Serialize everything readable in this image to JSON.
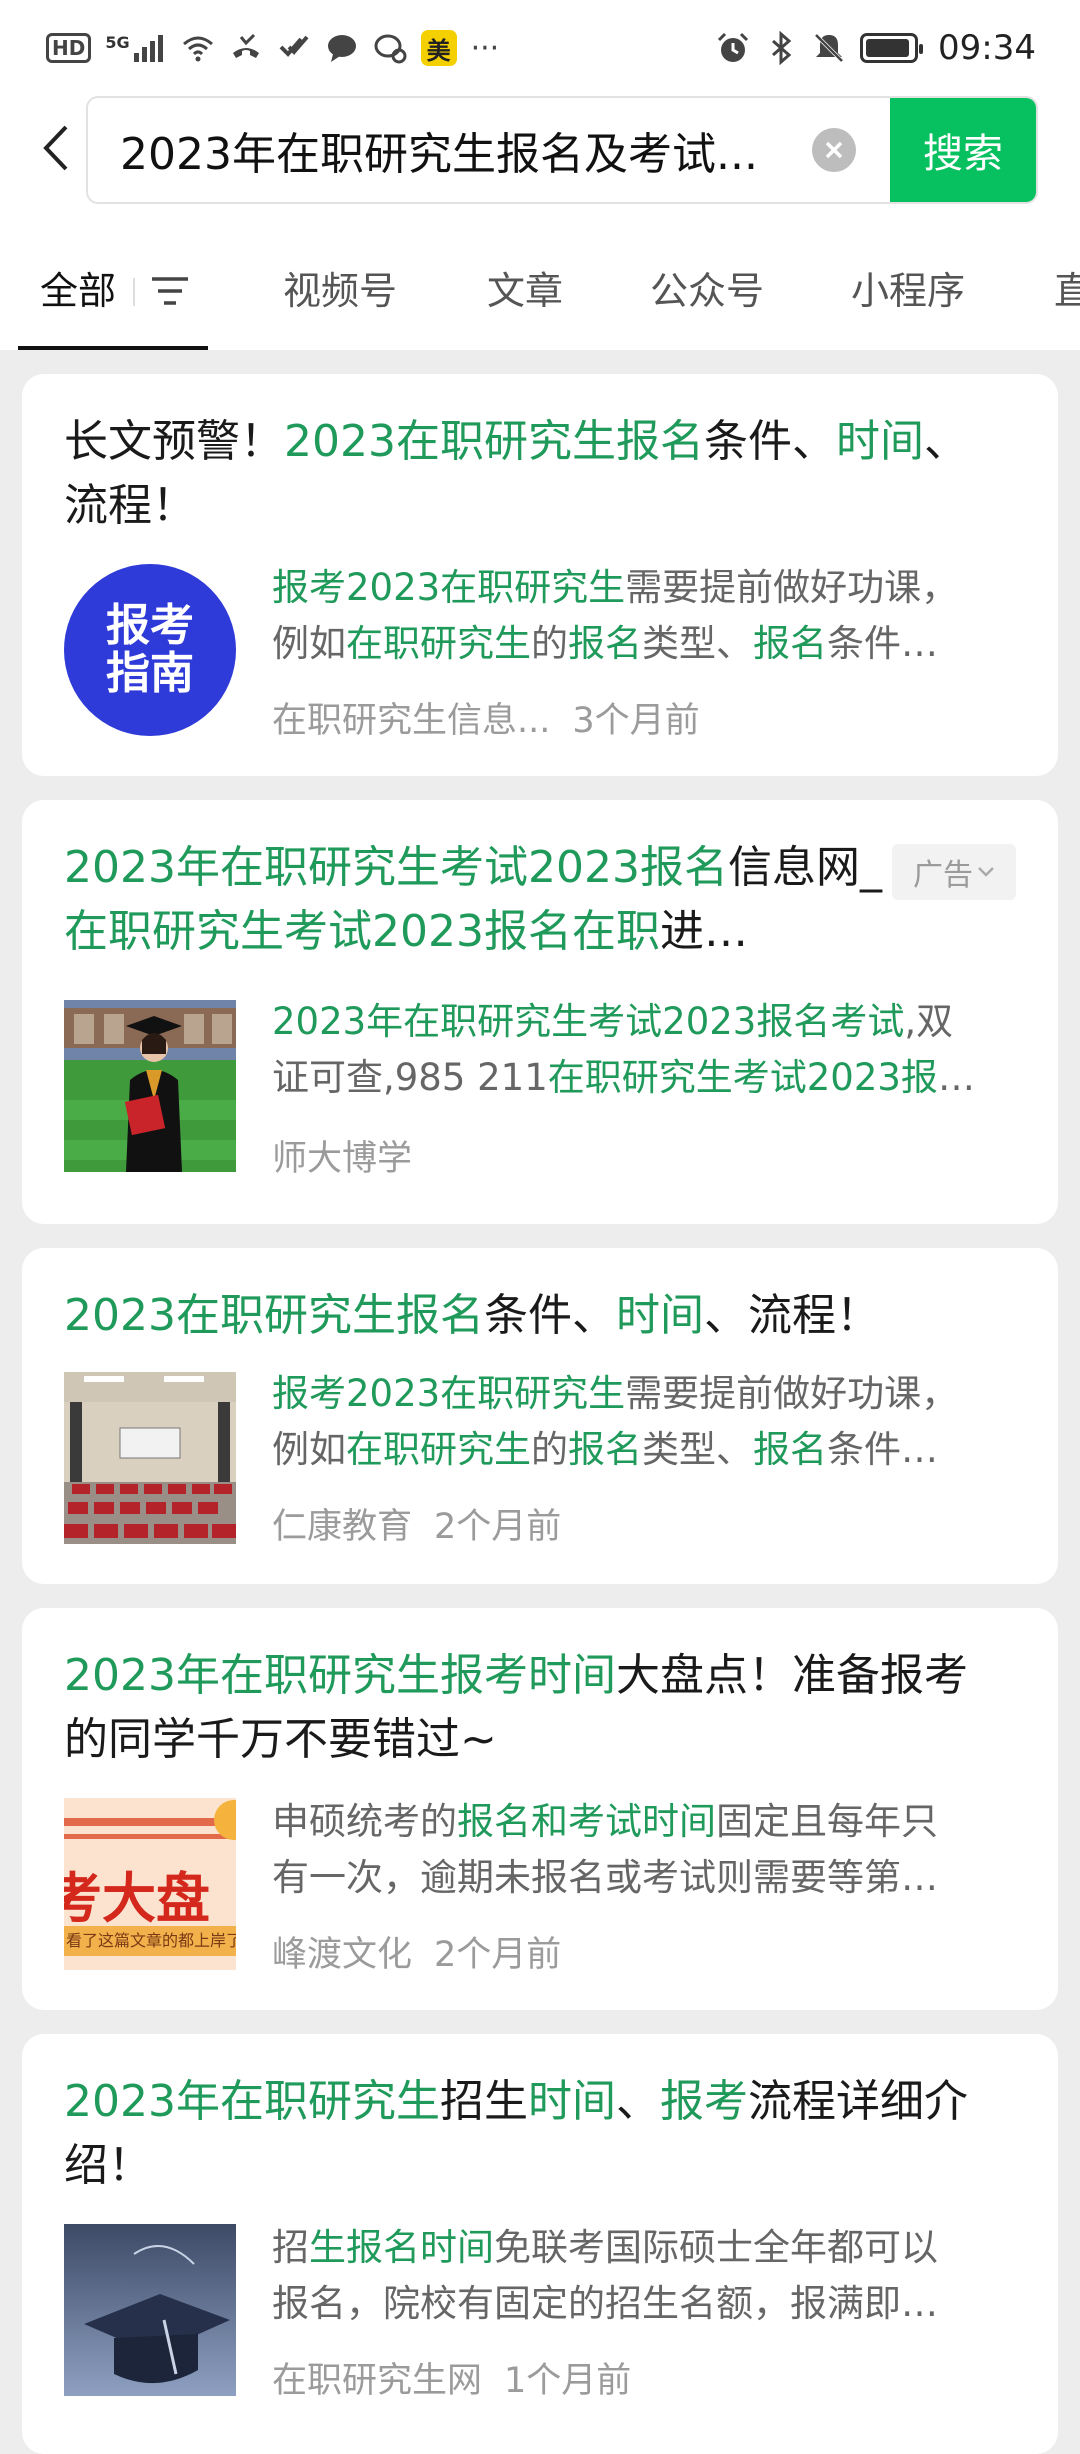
{
  "status_bar": {
    "hd": "HD",
    "network": "5G",
    "mei": "美",
    "more": "···",
    "time": "09:34"
  },
  "search": {
    "query": "2023年在职研究生报名及考试...",
    "button_label": "搜索",
    "accent": "#07c160"
  },
  "tabs": [
    "全部",
    "视频号",
    "文章",
    "公众号",
    "小程序",
    "直"
  ],
  "results": [
    {
      "title_parts": [
        {
          "t": "长文预警！",
          "h": false
        },
        {
          "t": "2023在职研究生报名",
          "h": true
        },
        {
          "t": "条件、",
          "h": false
        },
        {
          "t": "时间",
          "h": true
        },
        {
          "t": "、流程！",
          "h": false
        }
      ],
      "thumb_text": "报考指南",
      "snippet_line1": [
        {
          "t": "报考2023在职研究生",
          "h": true
        },
        {
          "t": "需要提前做好功课，",
          "h": false
        }
      ],
      "snippet_line2": [
        {
          "t": "例如",
          "h": false
        },
        {
          "t": "在职研究生",
          "h": true
        },
        {
          "t": "的",
          "h": false
        },
        {
          "t": "报名",
          "h": true
        },
        {
          "t": "类型、",
          "h": false
        },
        {
          "t": "报名",
          "h": true
        },
        {
          "t": "条件…",
          "h": false
        }
      ],
      "source": "在职研究生信息...",
      "time": "3个月前"
    },
    {
      "title_parts": [
        {
          "t": "2023年在职研究生考试2023报名",
          "h": true
        },
        {
          "t": "信息网_",
          "h": false
        },
        {
          "t": "在职研究生考试2023报名在职",
          "h": true
        },
        {
          "t": "进…",
          "h": false
        }
      ],
      "ad_label": "广告",
      "snippet_line1": [
        {
          "t": "2023年在职研究生考试2023报名考试",
          "h": true
        },
        {
          "t": ",双",
          "h": false
        }
      ],
      "snippet_line2": [
        {
          "t": "证可查,985 211",
          "h": false
        },
        {
          "t": "在职研究生考试2023报",
          "h": true
        },
        {
          "t": "…",
          "h": false
        }
      ],
      "source": "师大博学",
      "time": ""
    },
    {
      "title_parts": [
        {
          "t": "2023在职研究生报名",
          "h": true
        },
        {
          "t": "条件、",
          "h": false
        },
        {
          "t": "时间",
          "h": true
        },
        {
          "t": "、流程！",
          "h": false
        }
      ],
      "snippet_line1": [
        {
          "t": "报考2023在职研究生",
          "h": true
        },
        {
          "t": "需要提前做好功课，",
          "h": false
        }
      ],
      "snippet_line2": [
        {
          "t": "例如",
          "h": false
        },
        {
          "t": "在职研究生",
          "h": true
        },
        {
          "t": "的",
          "h": false
        },
        {
          "t": "报名",
          "h": true
        },
        {
          "t": "类型、",
          "h": false
        },
        {
          "t": "报名",
          "h": true
        },
        {
          "t": "条件…",
          "h": false
        }
      ],
      "source": "仁康教育",
      "time": "2个月前"
    },
    {
      "title_parts": [
        {
          "t": "2023年在职研究生报考时间",
          "h": true
        },
        {
          "t": "大盘点！准备报考的同学千万不要错过~",
          "h": false
        }
      ],
      "thumb_text": "考大盘",
      "thumb_sub": "看了这篇文章的都上岸了",
      "snippet_line1": [
        {
          "t": "申硕统考的",
          "h": false
        },
        {
          "t": "报名和考试时间",
          "h": true
        },
        {
          "t": "固定且每年只",
          "h": false
        }
      ],
      "snippet_line2": [
        {
          "t": "有一次，逾期未报名或考试则需要等第…",
          "h": false
        }
      ],
      "source": "峰渡文化",
      "time": "2个月前"
    },
    {
      "title_parts": [
        {
          "t": "2023年在职研究生",
          "h": true
        },
        {
          "t": "招生",
          "h": false
        },
        {
          "t": "时间",
          "h": true
        },
        {
          "t": "、",
          "h": false
        },
        {
          "t": "报考",
          "h": true
        },
        {
          "t": "流程详细介绍！",
          "h": false
        }
      ],
      "snippet_line1": [
        {
          "t": "招",
          "h": false
        },
        {
          "t": "生报名时间",
          "h": true
        },
        {
          "t": "免联考国际硕士全年都可以",
          "h": false
        }
      ],
      "snippet_line2": [
        {
          "t": "报名，院校有固定的招生名额，报满即…",
          "h": false
        }
      ],
      "source": "在职研究生网",
      "time": "1个月前"
    }
  ]
}
